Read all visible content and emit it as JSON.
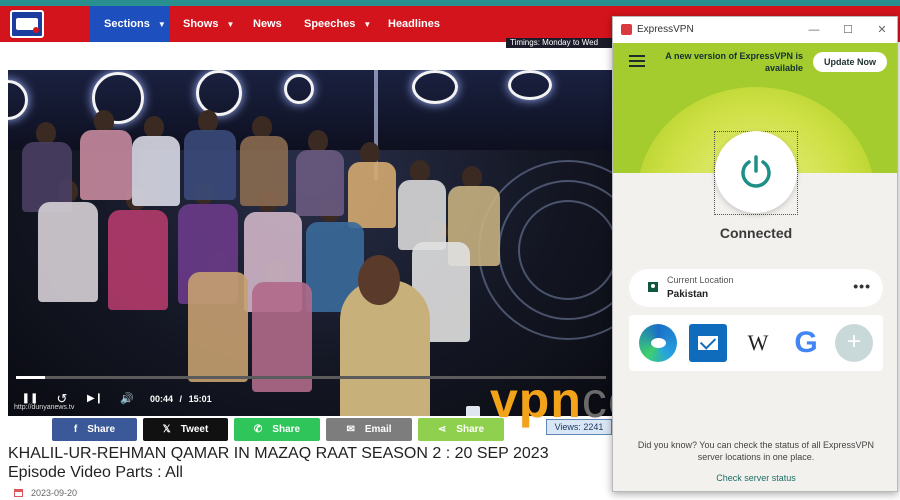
{
  "site": {
    "nav": [
      {
        "label": "Sections",
        "active": true,
        "has_caret": true
      },
      {
        "label": "Shows",
        "active": false,
        "has_caret": true
      },
      {
        "label": "News",
        "active": false,
        "has_caret": false
      },
      {
        "label": "Speeches",
        "active": false,
        "has_caret": true
      },
      {
        "label": "Headlines",
        "active": false,
        "has_caret": false
      }
    ],
    "timings_text": "Timings: Monday to Wed",
    "colors": {
      "nav_bg": "#d4141c",
      "nav_active": "#1e4fbf",
      "top_strip": "#2a8f8f"
    }
  },
  "video": {
    "watermark_url": "http://dunyanews.tv",
    "current_time": "00:44",
    "time_separator": "/",
    "duration": "15:01",
    "progress_fraction": 0.049,
    "controls": [
      {
        "name": "pause-button",
        "icon": "pause-icon",
        "glyph": "❚❚"
      },
      {
        "name": "replay-button",
        "icon": "replay-icon",
        "glyph": "↺"
      },
      {
        "name": "next-button",
        "icon": "skip-next-icon",
        "glyph": "▶❙"
      },
      {
        "name": "volume-button",
        "icon": "volume-icon",
        "glyph": "🔊"
      }
    ]
  },
  "share": {
    "buttons": [
      {
        "key": "facebook",
        "label": "Share",
        "icon_glyph": "f",
        "color": "#3b5998"
      },
      {
        "key": "twitter",
        "label": "Tweet",
        "icon_glyph": "𝕏",
        "color": "#111111"
      },
      {
        "key": "whatsapp",
        "label": "Share",
        "icon_glyph": "✆",
        "color": "#2fc55a"
      },
      {
        "key": "email",
        "label": "Email",
        "icon_glyph": "✉",
        "color": "#7d7d7d"
      },
      {
        "key": "sharethis",
        "label": "Share",
        "icon_glyph": "⋖",
        "color": "#8fd14f"
      }
    ],
    "views_text": "Views: 2241"
  },
  "article": {
    "headline": "KHALIL-UR-REHMAN QAMAR IN MAZAQ RAAT SEASON 2 : 20 SEP 2023 Episode Video Parts : All",
    "date": "2023-09-20"
  },
  "watermark": {
    "part_a": "vpn",
    "part_b": "central",
    "color_a": "#f2a31a",
    "color_b": "#6b6b6b"
  },
  "vpn_app": {
    "title": "ExpressVPN",
    "window_controls": {
      "minimize": "—",
      "maximize": "☐",
      "close": "✕"
    },
    "update_message": "A new version of ExpressVPN is available",
    "update_button": "Update Now",
    "status": "Connected",
    "location_label": "Current Location",
    "location_name": "Pakistan",
    "location_more": "•••",
    "shortcuts": [
      {
        "name": "edge-shortcut",
        "icon": "edge-browser-icon"
      },
      {
        "name": "mail-shortcut",
        "icon": "mail-icon"
      },
      {
        "name": "wikipedia-shortcut",
        "icon": "wikipedia-icon",
        "glyph": "W"
      },
      {
        "name": "google-shortcut",
        "icon": "google-icon",
        "glyph": "G"
      },
      {
        "name": "add-shortcut",
        "icon": "add-icon",
        "glyph": "+"
      }
    ],
    "tip": "Did you know? You can check the status of all ExpressVPN server locations in one place.",
    "check_link": "Check server status",
    "colors": {
      "hero": "#a5cc2e",
      "accent": "#1d8f86",
      "brand": "#da3940"
    }
  }
}
